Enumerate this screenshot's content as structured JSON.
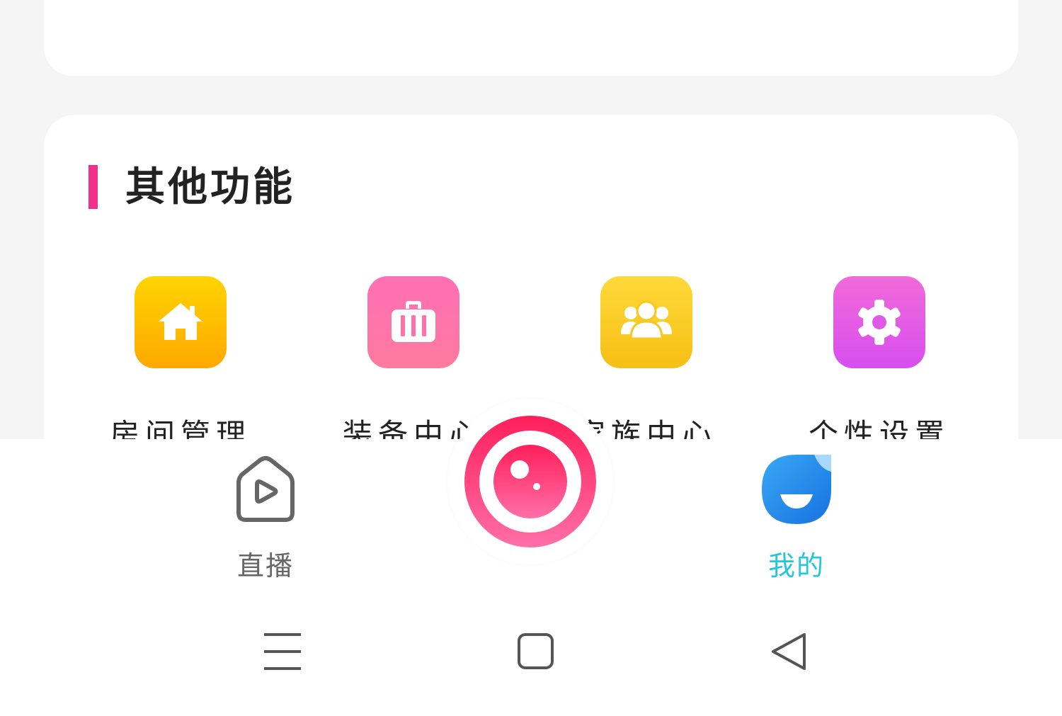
{
  "section": {
    "title": "其他功能"
  },
  "functions": [
    {
      "label": "房间管理",
      "icon": "house-icon",
      "color": "#ffb400"
    },
    {
      "label": "装备中心",
      "icon": "suitcase-icon",
      "color": "#ff72a8"
    },
    {
      "label": "家族中心",
      "icon": "group-icon",
      "color": "#f8c820"
    },
    {
      "label": "个性设置",
      "icon": "gear-icon",
      "color": "#e05ae8"
    }
  ],
  "tabbar": {
    "live_label": "直播",
    "mine_label": "我的",
    "center_icon": "camera-lens-icon",
    "active_color": "#26c6da",
    "inactive_color": "#666666"
  },
  "system_nav": {
    "menu_icon": "menu-icon",
    "home_icon": "home-square-icon",
    "back_icon": "back-triangle-icon"
  }
}
